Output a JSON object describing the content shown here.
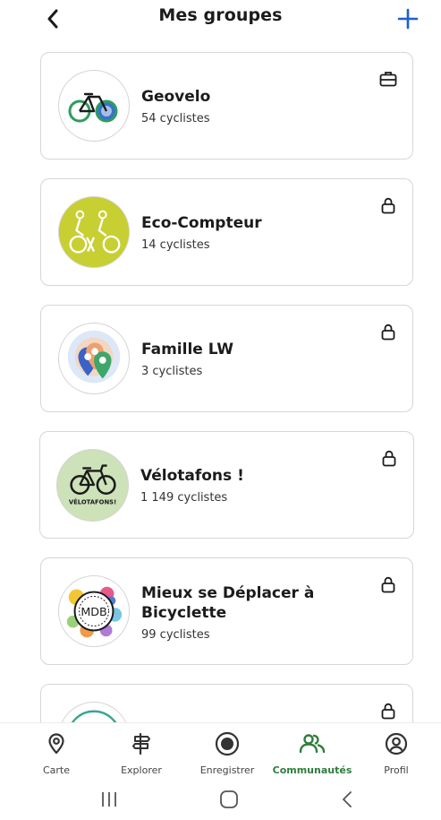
{
  "header": {
    "title": "Mes groupes",
    "back_icon": "chevron-left-icon",
    "add_icon": "plus-icon"
  },
  "groups": [
    {
      "name": "Geovelo",
      "count": "54 cyclistes",
      "badge_icon": "briefcase-icon"
    },
    {
      "name": "Eco-Compteur",
      "count": "14 cyclistes",
      "badge_icon": "lock-icon"
    },
    {
      "name": "Famille LW",
      "count": "3 cyclistes",
      "badge_icon": "lock-icon"
    },
    {
      "name": "Vélotafons !",
      "count": "1 149 cyclistes",
      "badge_icon": "lock-icon",
      "logo_text": "VÉLOTAFONS!"
    },
    {
      "name": "Mieux se Déplacer à Bicyclette",
      "count": "99 cyclistes",
      "badge_icon": "lock-icon",
      "logo_text": "MDB"
    },
    {
      "name": "",
      "count": "",
      "badge_icon": "lock-icon"
    }
  ],
  "nav": {
    "items": [
      {
        "label": "Carte",
        "icon": "map-pin-icon"
      },
      {
        "label": "Explorer",
        "icon": "signpost-icon"
      },
      {
        "label": "Enregistrer",
        "icon": "record-icon"
      },
      {
        "label": "Communautés",
        "icon": "people-icon",
        "active": true
      },
      {
        "label": "Profil",
        "icon": "profile-icon"
      }
    ]
  },
  "colors": {
    "accent_blue": "#1a5fd1",
    "active_green": "#2f7d3c",
    "card_border": "#d6d6d6"
  }
}
